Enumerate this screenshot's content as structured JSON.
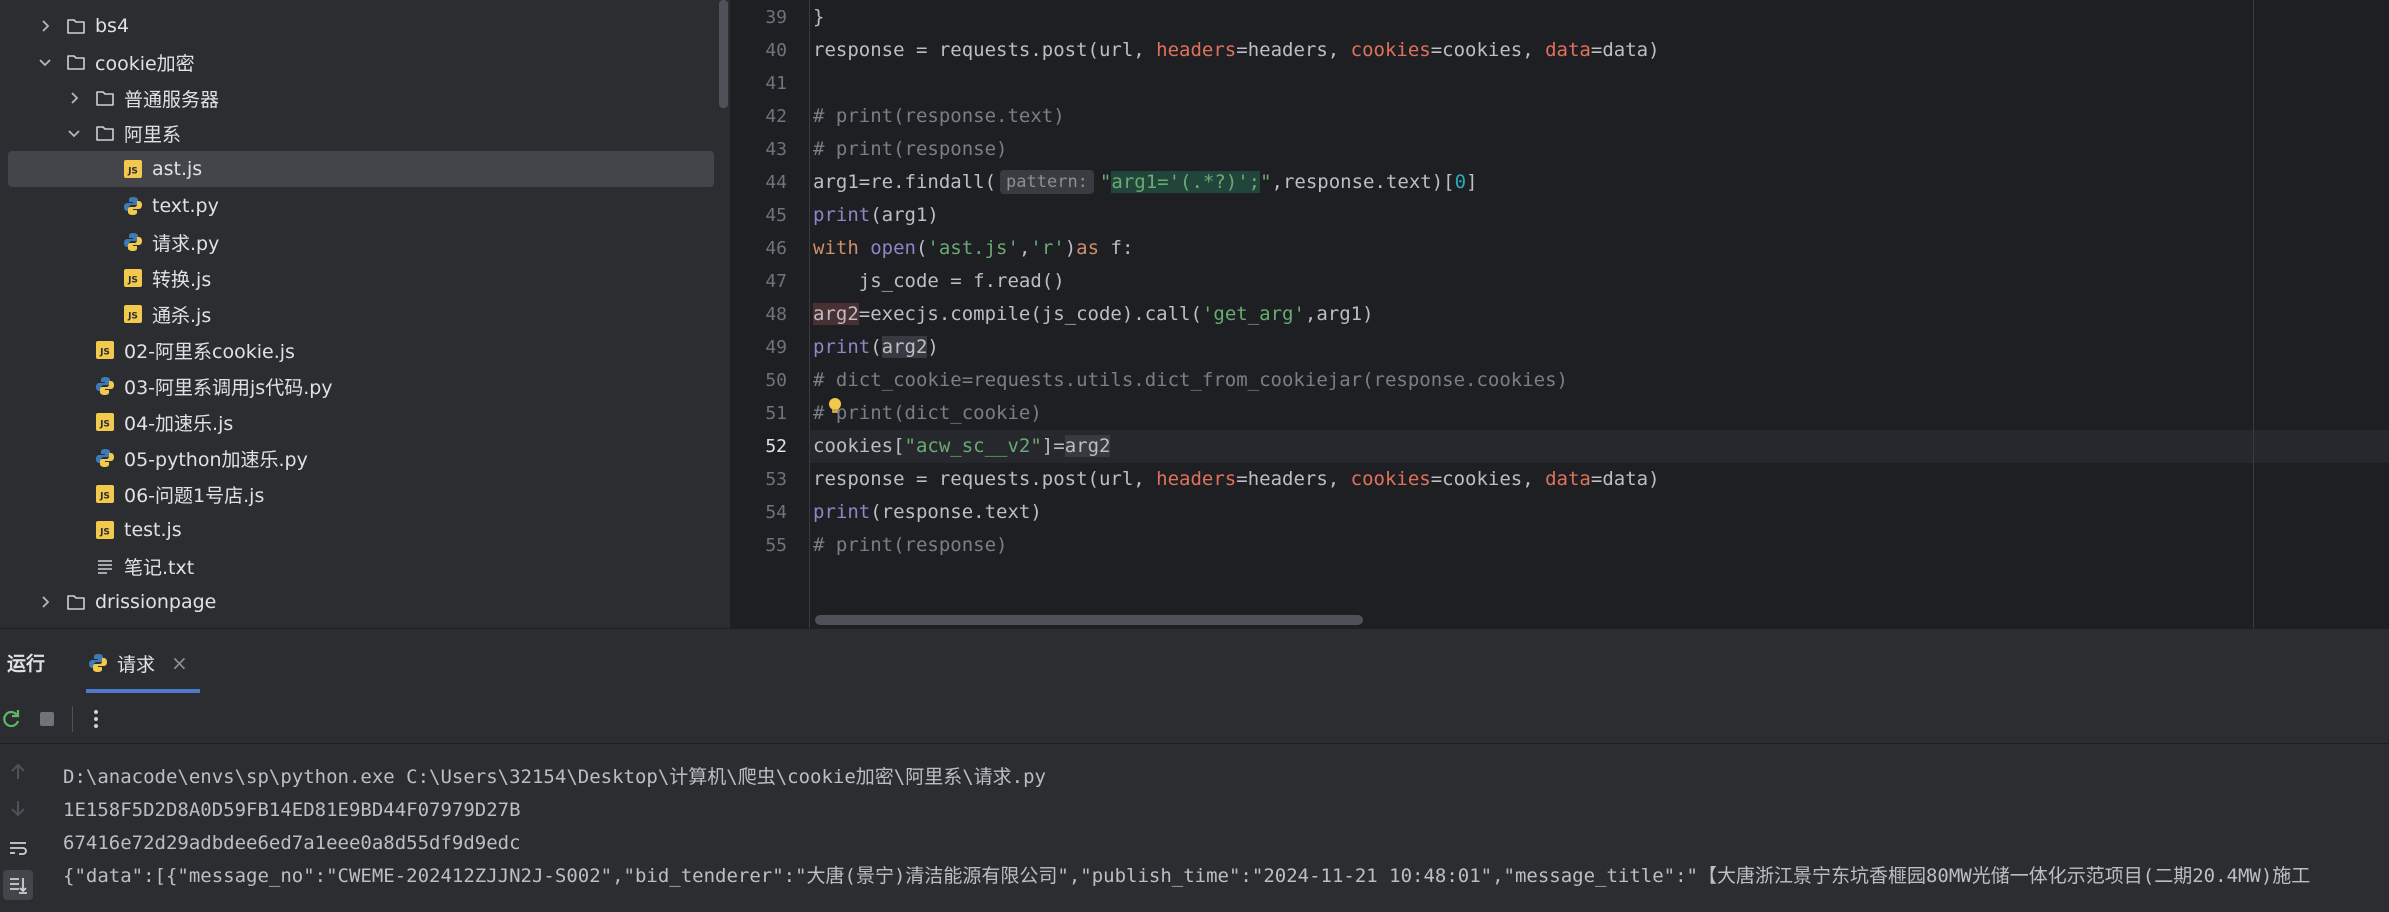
{
  "project_tree": {
    "items": [
      {
        "label": "bs4",
        "type": "folder",
        "state": "collapsed",
        "depth": 0
      },
      {
        "label": "cookie加密",
        "type": "folder",
        "state": "expanded",
        "depth": 0
      },
      {
        "label": "普通服务器",
        "type": "folder",
        "state": "collapsed",
        "depth": 1
      },
      {
        "label": "阿里系",
        "type": "folder",
        "state": "expanded",
        "depth": 1
      },
      {
        "label": "ast.js",
        "type": "js",
        "depth": 2,
        "selected": true
      },
      {
        "label": "text.py",
        "type": "py",
        "depth": 2
      },
      {
        "label": "请求.py",
        "type": "py",
        "depth": 2
      },
      {
        "label": "转换.js",
        "type": "js",
        "depth": 2
      },
      {
        "label": "通杀.js",
        "type": "js",
        "depth": 2
      },
      {
        "label": "02-阿里系cookie.js",
        "type": "js",
        "depth": 1
      },
      {
        "label": "03-阿里系调用js代码.py",
        "type": "py",
        "depth": 1
      },
      {
        "label": "04-加速乐.js",
        "type": "js",
        "depth": 1
      },
      {
        "label": "05-python加速乐.py",
        "type": "py",
        "depth": 1
      },
      {
        "label": "06-问题1号店.js",
        "type": "js",
        "depth": 1
      },
      {
        "label": "test.js",
        "type": "js",
        "depth": 1
      },
      {
        "label": "笔记.txt",
        "type": "txt",
        "depth": 1
      },
      {
        "label": "drissionpage",
        "type": "folder",
        "state": "collapsed",
        "depth": 0
      }
    ]
  },
  "editor": {
    "current_line": 52,
    "lines": [
      {
        "n": 39,
        "tokens": [
          [
            "p",
            "}"
          ]
        ]
      },
      {
        "n": 40,
        "tokens": [
          [
            "p",
            "response = requests.post(url, "
          ],
          [
            "kwarg",
            "headers"
          ],
          [
            "p",
            "=headers, "
          ],
          [
            "kwarg",
            "cookies"
          ],
          [
            "p",
            "=cookies, "
          ],
          [
            "kwarg",
            "data"
          ],
          [
            "p",
            "=data)"
          ]
        ]
      },
      {
        "n": 41,
        "tokens": []
      },
      {
        "n": 42,
        "tokens": [
          [
            "cmt",
            "# print(response.text)"
          ]
        ]
      },
      {
        "n": 43,
        "tokens": [
          [
            "cmt",
            "# print(response)"
          ]
        ]
      },
      {
        "n": 44,
        "tokens": [
          [
            "p",
            "arg1=re.findall("
          ],
          [
            "hint",
            "pattern:"
          ],
          [
            "str",
            "\""
          ],
          [
            "strhl",
            "arg1='(.*?)';"
          ],
          [
            "str",
            "\""
          ],
          [
            "p",
            ",response.text)["
          ],
          [
            "num",
            "0"
          ],
          [
            "p",
            "]"
          ]
        ]
      },
      {
        "n": 45,
        "tokens": [
          [
            "bi",
            "print"
          ],
          [
            "p",
            "(arg1)"
          ]
        ]
      },
      {
        "n": 46,
        "tokens": [
          [
            "kw",
            "with "
          ],
          [
            "bi",
            "open"
          ],
          [
            "p",
            "("
          ],
          [
            "str",
            "'ast.js'"
          ],
          [
            "p",
            ","
          ],
          [
            "str",
            "'r'"
          ],
          [
            "p",
            ")"
          ],
          [
            "kw",
            "as"
          ],
          [
            "p",
            " f:"
          ]
        ]
      },
      {
        "n": 47,
        "tokens": [
          [
            "p",
            "    js_code = f.read()"
          ]
        ]
      },
      {
        "n": 48,
        "tokens": [
          [
            "err",
            "arg2"
          ],
          [
            "p",
            "=execjs.compile(js_code).call("
          ],
          [
            "str",
            "'get_arg'"
          ],
          [
            "p",
            ",arg1)"
          ]
        ]
      },
      {
        "n": 49,
        "tokens": [
          [
            "bi",
            "print"
          ],
          [
            "p",
            "("
          ],
          [
            "var",
            "arg2"
          ],
          [
            "p",
            ")"
          ]
        ]
      },
      {
        "n": 50,
        "tokens": [
          [
            "cmt",
            "# dict_cookie=requests.utils.dict_from_cookiejar(response.cookies)"
          ]
        ]
      },
      {
        "n": 51,
        "tokens": [
          [
            "cmt",
            "# print(dict_cookie)"
          ]
        ]
      },
      {
        "n": 52,
        "tokens": [
          [
            "p",
            "cookies["
          ],
          [
            "str",
            "\"acw_sc__v2\""
          ],
          [
            "p",
            "]="
          ],
          [
            "var",
            "arg2"
          ]
        ]
      },
      {
        "n": 53,
        "tokens": [
          [
            "p",
            "response = requests.post(url, "
          ],
          [
            "kwarg",
            "headers"
          ],
          [
            "p",
            "=headers, "
          ],
          [
            "kwarg",
            "cookies"
          ],
          [
            "p",
            "=cookies, "
          ],
          [
            "kwarg",
            "data"
          ],
          [
            "p",
            "=data)"
          ]
        ]
      },
      {
        "n": 54,
        "tokens": [
          [
            "bi",
            "print"
          ],
          [
            "p",
            "(response.text)"
          ]
        ]
      },
      {
        "n": 55,
        "tokens": [
          [
            "cmt",
            "# print(response)"
          ]
        ]
      }
    ]
  },
  "run_panel": {
    "title": "运行",
    "tab_label": "请求",
    "tab_close": "×",
    "console_lines": [
      "D:\\anacode\\envs\\sp\\python.exe C:\\Users\\32154\\Desktop\\计算机\\爬虫\\cookie加密\\阿里系\\请求.py",
      "1E158F5D2D8A0D59FB14ED81E9BD44F07979D27B",
      "67416e72d29adbdee6ed7a1eee0a8d55df9d9edc",
      "{\"data\":[{\"message_no\":\"CWEME-202412ZJJN2J-S002\",\"bid_tenderer\":\"大唐(景宁)清洁能源有限公司\",\"publish_time\":\"2024-11-21 10:48:01\",\"message_title\":\"【大唐浙江景宁东坑香榧园80MW光储一体化示范项目(二期20.4MW)施工"
    ]
  },
  "colors": {
    "tree_bg": "#2b2d30",
    "editor_bg": "#1e1f22",
    "selection": "#43454a",
    "accent": "#4d78cc",
    "keyword": "#cf8e6d",
    "string": "#6aab73",
    "comment": "#7a7e85"
  },
  "icons": [
    "chevron-right-icon",
    "chevron-down-icon",
    "folder-icon",
    "js-file-icon",
    "python-file-icon",
    "text-file-icon",
    "rerun-icon",
    "stop-icon",
    "more-icon",
    "up-arrow-icon",
    "down-arrow-icon",
    "soft-wrap-icon",
    "scroll-to-end-icon",
    "bulb-icon",
    "python-icon",
    "close-icon"
  ]
}
